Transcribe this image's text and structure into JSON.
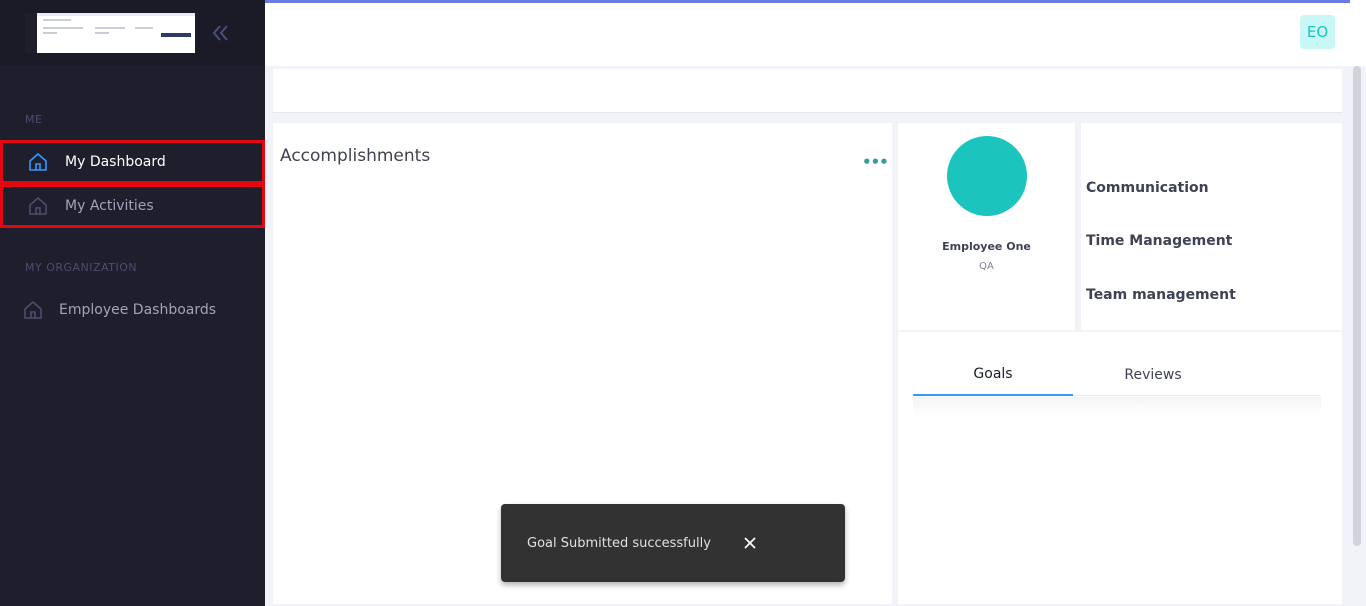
{
  "sidebar": {
    "sections": [
      {
        "title": "ME"
      },
      {
        "title": "MY ORGANIZATION"
      }
    ],
    "items": [
      {
        "label": "My Dashboard",
        "icon": "home-icon",
        "active": true
      },
      {
        "label": "My Activities",
        "icon": "home-icon",
        "active": false
      },
      {
        "label": "Employee Dashboards",
        "icon": "home-icon",
        "active": false
      }
    ]
  },
  "topbar": {
    "user_initials": "EO"
  },
  "accomplishments": {
    "title": "Accomplishments",
    "more_label": "•••"
  },
  "profile": {
    "name": "Employee One",
    "role": "QA"
  },
  "skills": [
    "Communication",
    "Time Management",
    "Team management"
  ],
  "tabs": [
    {
      "label": "Goals",
      "active": true
    },
    {
      "label": "Reviews",
      "active": false
    }
  ],
  "toast": {
    "message": "Goal Submitted successfully"
  },
  "colors": {
    "sidebar_bg": "#1e1e2d",
    "accent": "#3699ff",
    "teal": "#1bc5bd",
    "highlight_border": "#e3070f"
  }
}
